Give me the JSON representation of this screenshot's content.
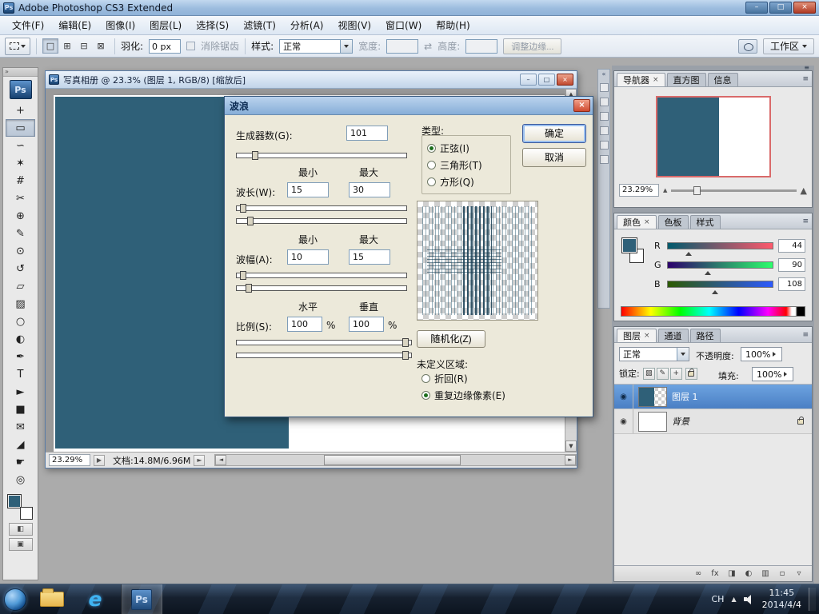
{
  "ui": {
    "ps_logo": "Ps",
    "close_glyph": "×",
    "min_glyph": "–",
    "max_glyph": "□",
    "collapse_left": "«",
    "collapse_right": "»",
    "panel_menu": "≡",
    "eye": "◉",
    "mountain": "▲",
    "tray_up": "▲",
    "link_wh": "⇄",
    "scroll_up": "▲",
    "scroll_down": "▼",
    "scroll_left": "◄",
    "scroll_right": "►",
    "play": "▶",
    "quickmask": "◧",
    "screenmode": "▣"
  },
  "app": {
    "title": "Adobe Photoshop CS3 Extended"
  },
  "menu": {
    "items": [
      {
        "label": "文件(F)",
        "name": "menu-file"
      },
      {
        "label": "编辑(E)",
        "name": "menu-edit"
      },
      {
        "label": "图像(I)",
        "name": "menu-image"
      },
      {
        "label": "图层(L)",
        "name": "menu-layer"
      },
      {
        "label": "选择(S)",
        "name": "menu-select"
      },
      {
        "label": "滤镜(T)",
        "name": "menu-filter"
      },
      {
        "label": "分析(A)",
        "name": "menu-analysis"
      },
      {
        "label": "视图(V)",
        "name": "menu-view"
      },
      {
        "label": "窗口(W)",
        "name": "menu-window"
      },
      {
        "label": "帮助(H)",
        "name": "menu-help"
      }
    ]
  },
  "options": {
    "mode_buttons": [
      {
        "glyph": "□",
        "name": "new-selection-mode",
        "selected": true
      },
      {
        "glyph": "⊞",
        "name": "add-selection-mode"
      },
      {
        "glyph": "⊟",
        "name": "subtract-selection-mode"
      },
      {
        "glyph": "⊠",
        "name": "intersect-selection-mode"
      }
    ],
    "feather_label": "羽化:",
    "feather_value": "0 px",
    "antialias_label": "消除锯齿",
    "style_label": "样式:",
    "style_value": "正常",
    "width_label": "宽度:",
    "height_label": "高度:",
    "refine_edge_label": "调整边缘...",
    "workspace_label": "工作区"
  },
  "toolbox": {
    "tools": [
      {
        "name": "move-tool",
        "glyph": "+"
      },
      {
        "name": "rectangular-marquee-tool",
        "glyph": "▭",
        "selected": true
      },
      {
        "name": "lasso-tool",
        "glyph": "∽"
      },
      {
        "name": "quick-selection-tool",
        "glyph": "✶"
      },
      {
        "name": "crop-tool",
        "glyph": "#"
      },
      {
        "name": "slice-tool",
        "glyph": "✂"
      },
      {
        "name": "healing-brush-tool",
        "glyph": "⊕"
      },
      {
        "name": "brush-tool",
        "glyph": "✎"
      },
      {
        "name": "clone-stamp-tool",
        "glyph": "⊙"
      },
      {
        "name": "history-brush-tool",
        "glyph": "↺"
      },
      {
        "name": "eraser-tool",
        "glyph": "▱"
      },
      {
        "name": "gradient-tool",
        "glyph": "▨"
      },
      {
        "name": "blur-tool",
        "glyph": "○"
      },
      {
        "name": "dodge-tool",
        "glyph": "◐"
      },
      {
        "name": "pen-tool",
        "glyph": "✒"
      },
      {
        "name": "type-tool",
        "glyph": "T"
      },
      {
        "name": "path-selection-tool",
        "glyph": "►"
      },
      {
        "name": "shape-tool",
        "glyph": "■"
      },
      {
        "name": "notes-tool",
        "glyph": "✉"
      },
      {
        "name": "eyedropper-tool",
        "glyph": "◢"
      },
      {
        "name": "hand-tool",
        "glyph": "☛"
      },
      {
        "name": "zoom-tool",
        "glyph": "◎"
      }
    ]
  },
  "doc": {
    "title": "写真相册 @ 23.3% (图层 1, RGB/8) [缩放后]",
    "zoom": "23.29%",
    "info": "文档:14.8M/6.96M"
  },
  "dialog": {
    "title": "波浪",
    "generators_label": "生成器数(G):",
    "generators_value": "101",
    "min": "最小",
    "max": "最大",
    "wavelength_label": "波长(W):",
    "wavelength_min": "15",
    "wavelength_max": "30",
    "amplitude_label": "波幅(A):",
    "amplitude_min": "10",
    "amplitude_max": "15",
    "horizontal": "水平",
    "vertical": "垂直",
    "scale_label": "比例(S):",
    "scale_h": "100",
    "scale_v": "100",
    "percent": "%",
    "type_label": "类型:",
    "types": [
      {
        "label": "正弦(I)",
        "checked": true,
        "name": "type-sine-radio"
      },
      {
        "label": "三角形(T)",
        "name": "type-triangle-radio"
      },
      {
        "label": "方形(Q)",
        "name": "type-square-radio"
      }
    ],
    "ok": "确定",
    "cancel": "取消",
    "randomize": "随机化(Z)",
    "undefined_label": "未定义区域:",
    "undefined_options": [
      {
        "label": "折回(R)",
        "name": "wrap-around-radio"
      },
      {
        "label": "重复边缘像素(E)",
        "checked": true,
        "name": "repeat-edge-pixels-radio"
      }
    ]
  },
  "navigator": {
    "tabs": [
      {
        "label": "导航器",
        "active": true,
        "name": "tab-navigator"
      },
      {
        "label": "直方图",
        "name": "tab-histogram"
      },
      {
        "label": "信息",
        "name": "tab-info"
      }
    ],
    "zoom": "23.29%"
  },
  "color": {
    "tabs": [
      {
        "label": "颜色",
        "active": true,
        "name": "tab-color"
      },
      {
        "label": "色板",
        "name": "tab-swatches"
      },
      {
        "label": "样式",
        "name": "tab-styles"
      }
    ],
    "channels": [
      {
        "label": "R",
        "value": "44",
        "variant": "r",
        "name": "red-channel-row"
      },
      {
        "label": "G",
        "value": "90",
        "variant": "g",
        "name": "green-channel-row"
      },
      {
        "label": "B",
        "value": "108",
        "variant": "b",
        "name": "blue-channel-row"
      }
    ]
  },
  "layers": {
    "tabs": [
      {
        "label": "图层",
        "active": true,
        "name": "tab-layers"
      },
      {
        "label": "通道",
        "name": "tab-channels"
      },
      {
        "label": "路径",
        "name": "tab-paths"
      }
    ],
    "blend_mode": "正常",
    "opacity_label": "不透明度:",
    "opacity_value": "100%",
    "lock_label": "锁定:",
    "lock_icons": [
      {
        "glyph": "▨",
        "name": "lock-transparency-icon"
      },
      {
        "glyph": "✎",
        "name": "lock-paint-icon"
      },
      {
        "glyph": "+",
        "name": "lock-position-icon"
      }
    ],
    "fill_label": "填充:",
    "fill_value": "100%",
    "rows": [
      {
        "label": "图层 1",
        "selected": true,
        "variant": "layer1",
        "name": "layer-row-1"
      },
      {
        "label": "背景",
        "locked": true,
        "variant": "bg",
        "name": "layer-row-background"
      }
    ],
    "bottom_icons": [
      {
        "glyph": "∞",
        "name": "link-layers-icon"
      },
      {
        "glyph": "fx",
        "name": "layer-style-icon"
      },
      {
        "glyph": "◨",
        "name": "add-layer-mask-icon"
      },
      {
        "glyph": "◐",
        "name": "adjustment-layer-icon"
      },
      {
        "glyph": "▥",
        "name": "new-group-icon"
      },
      {
        "glyph": "▫",
        "name": "new-layer-icon"
      },
      {
        "glyph": "▿",
        "name": "delete-layer-icon"
      }
    ]
  },
  "taskbar": {
    "lang": "CH",
    "time": "11:45",
    "date": "2014/4/4"
  }
}
